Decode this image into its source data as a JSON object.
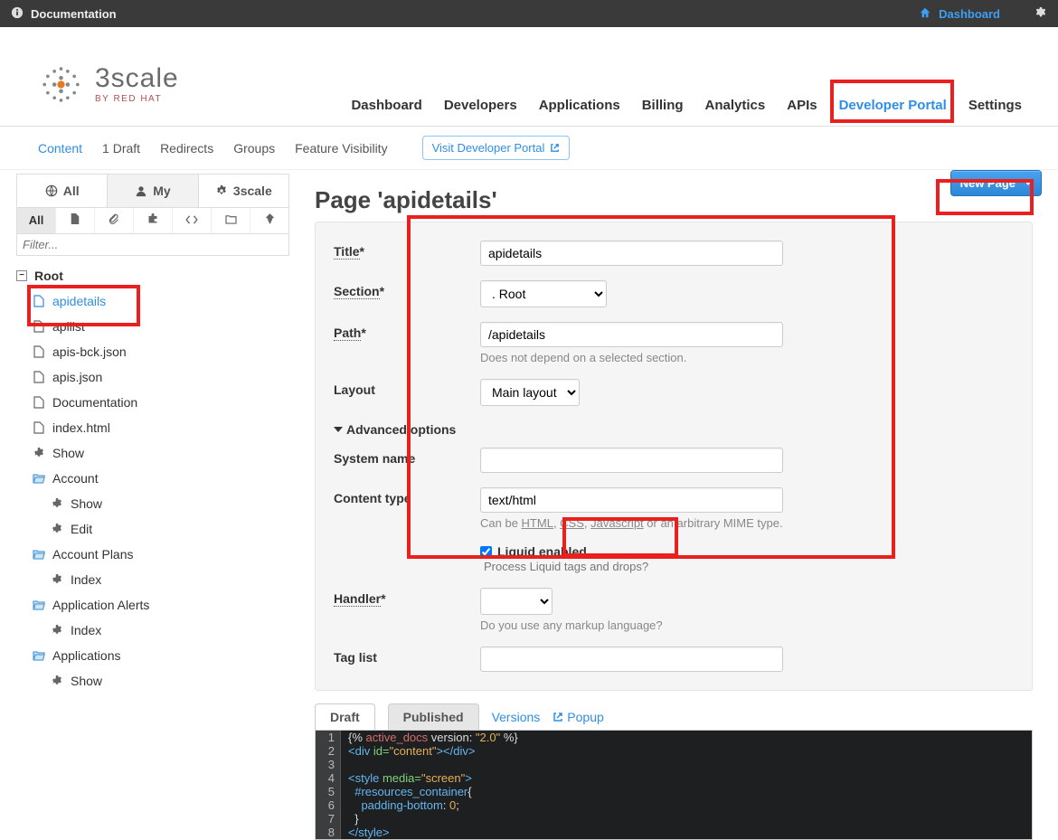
{
  "topbar": {
    "doc": "Documentation",
    "dashboard": "Dashboard"
  },
  "brand": {
    "name": "3scale",
    "by": "BY RED HAT"
  },
  "mainnav": {
    "dashboard": "Dashboard",
    "developers": "Developers",
    "applications": "Applications",
    "billing": "Billing",
    "analytics": "Analytics",
    "apis": "APIs",
    "devportal": "Developer Portal",
    "settings": "Settings"
  },
  "subnav": {
    "content": "Content",
    "draft": "1 Draft",
    "redirects": "Redirects",
    "groups": "Groups",
    "feature": "Feature Visibility",
    "visit": "Visit Developer Portal"
  },
  "sidetabs": {
    "all": "All",
    "my": "My",
    "threescale": "3scale"
  },
  "iconrow": {
    "all": "All"
  },
  "filter_placeholder": "Filter...",
  "tree": {
    "root": "Root",
    "items": [
      "apidetails",
      "apilist",
      "apis-bck.json",
      "apis.json",
      "Documentation",
      "index.html"
    ],
    "show": "Show",
    "account": "Account",
    "account_show": "Show",
    "account_edit": "Edit",
    "plans": "Account Plans",
    "plans_index": "Index",
    "alerts": "Application Alerts",
    "alerts_index": "Index",
    "apps": "Applications",
    "apps_show": "Show"
  },
  "page": {
    "heading": "Page 'apidetails'",
    "newpage": "New Page",
    "labels": {
      "title": "Title",
      "section": "Section",
      "path": "Path",
      "layout": "Layout",
      "advanced": "Advanced options",
      "system": "System name",
      "ctype": "Content type",
      "liquid": "Liquid enabled",
      "handler": "Handler",
      "taglist": "Tag list"
    },
    "values": {
      "title": "apidetails",
      "section_option": ". Root",
      "path": "/apidetails",
      "path_hint": "Does not depend on a selected section.",
      "layout_option": "Main layout",
      "system": "",
      "ctype": "text/html",
      "ctype_hint_pre": "Can be ",
      "ctype_hint_html": "HTML",
      "ctype_hint_css": "CSS",
      "ctype_hint_js": "Javascript",
      "ctype_hint_post": " or an arbitrary MIME type.",
      "liquid_hint": "Process Liquid tags and drops?",
      "handler_hint": "Do you use any markup language?",
      "taglist": ""
    },
    "editor_tabs": {
      "draft": "Draft",
      "published": "Published",
      "versions": "Versions",
      "popup": "Popup"
    },
    "code": {
      "l1_a": "{% ",
      "l1_b": "active_docs",
      "l1_c": " version:",
      "l1_d": " \"2.0\"",
      "l1_e": " %}",
      "l2": "<div id=\"content\"></div>",
      "l4": "<style media=\"screen\">",
      "l5": "  #resources_container{",
      "l6": "    padding-bottom: 0;",
      "l7": "  }",
      "l8": "</style>"
    }
  }
}
